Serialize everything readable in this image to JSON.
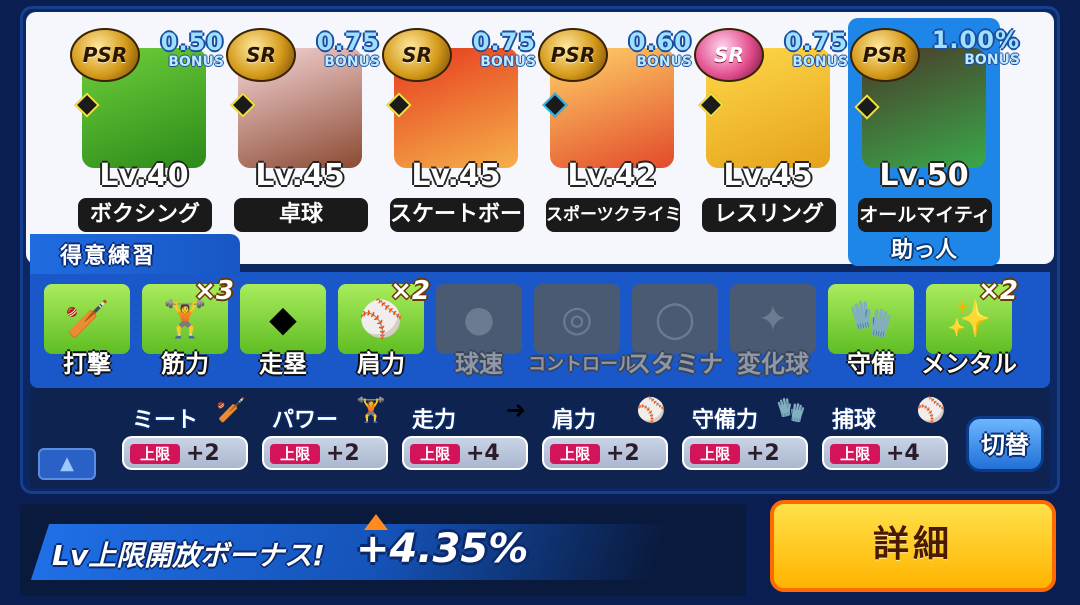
{
  "cards": [
    {
      "rarity": "PSR",
      "bonus_value": "0.50",
      "bonus_label": "BONUS",
      "level": "Lv.40",
      "sport": "ボクシング",
      "diamond": "yellow",
      "colors": [
        "#6fcf3a",
        "#2b8a1a"
      ]
    },
    {
      "rarity": "SR",
      "bonus_value": "0.75",
      "bonus_label": "BONUS",
      "level": "Lv.45",
      "sport": "卓球",
      "diamond": "yellow",
      "colors": [
        "#f6d6d8",
        "#8b4a32"
      ]
    },
    {
      "rarity": "SR",
      "bonus_value": "0.75",
      "bonus_label": "BONUS",
      "level": "Lv.45",
      "sport": "スケートボード",
      "diamond": "yellow",
      "colors": [
        "#e63a1e",
        "#f5b04a"
      ]
    },
    {
      "rarity": "PSR",
      "bonus_value": "0.60",
      "bonus_label": "BONUS",
      "level": "Lv.42",
      "sport": "スポーツクライミング",
      "diamond": "blue",
      "colors": [
        "#ffd36a",
        "#e24a2a"
      ]
    },
    {
      "rarity": "SR",
      "bonus_value": "0.75",
      "bonus_label": "BONUS",
      "level": "Lv.45",
      "sport": "レスリング",
      "diamond": "yellow",
      "colors": [
        "#ffd84a",
        "#e5a21a"
      ],
      "rarity_color": "pink"
    },
    {
      "rarity": "PSR",
      "bonus_value": "1.00%",
      "bonus_label": "BONUS",
      "level": "Lv.50",
      "sport": "オールマイティ",
      "diamond": "yellow",
      "colors": [
        "#4a3a2a",
        "#3aa84a"
      ]
    }
  ],
  "helper_label": "助っ人",
  "practice_title": "得意練習",
  "practices": [
    {
      "label": "打撃",
      "active": true,
      "icon": "bat-icon",
      "glyph": "🏏",
      "mult": ""
    },
    {
      "label": "筋力",
      "active": true,
      "icon": "dumbbell-icon",
      "glyph": "🏋",
      "mult": "×3"
    },
    {
      "label": "走塁",
      "active": true,
      "icon": "base-icon",
      "glyph": "◆",
      "mult": ""
    },
    {
      "label": "肩力",
      "active": true,
      "icon": "throw-icon",
      "glyph": "⚾",
      "mult": "×2"
    },
    {
      "label": "球速",
      "active": false,
      "icon": "fastball-icon",
      "glyph": "●",
      "mult": ""
    },
    {
      "label": "コントロール",
      "active": false,
      "icon": "target-icon",
      "glyph": "◎",
      "mult": ""
    },
    {
      "label": "スタミナ",
      "active": false,
      "icon": "tire-icon",
      "glyph": "◯",
      "mult": ""
    },
    {
      "label": "変化球",
      "active": false,
      "icon": "breaking-ball-icon",
      "glyph": "✦",
      "mult": ""
    },
    {
      "label": "守備",
      "active": true,
      "icon": "glove-icon",
      "glyph": "🧤",
      "mult": ""
    },
    {
      "label": "メンタル",
      "active": true,
      "icon": "sparkle-icon",
      "glyph": "✨",
      "mult": "×2"
    }
  ],
  "stats": [
    {
      "name": "ミート",
      "icon": "bat-icon",
      "glyph": "🏏",
      "cap": "上限",
      "plus": "+2"
    },
    {
      "name": "パワー",
      "icon": "dumbbell-icon",
      "glyph": "🏋",
      "cap": "上限",
      "plus": "+2"
    },
    {
      "name": "走力",
      "icon": "runner-icon",
      "glyph": "➜",
      "cap": "上限",
      "plus": "+4"
    },
    {
      "name": "肩力",
      "icon": "throw-arc-icon",
      "glyph": "⚾",
      "cap": "上限",
      "plus": "+2"
    },
    {
      "name": "守備力",
      "icon": "glove-icon",
      "glyph": "🧤",
      "cap": "上限",
      "plus": "+2"
    },
    {
      "name": "捕球",
      "icon": "catch-icon",
      "glyph": "⚾",
      "cap": "上限",
      "plus": "+4"
    }
  ],
  "switch_label": "切替",
  "up_glyph": "▲",
  "lv_bonus": {
    "label": "Lv上限開放ボーナス!",
    "value": "+4.35%"
  },
  "detail_label": "詳細"
}
